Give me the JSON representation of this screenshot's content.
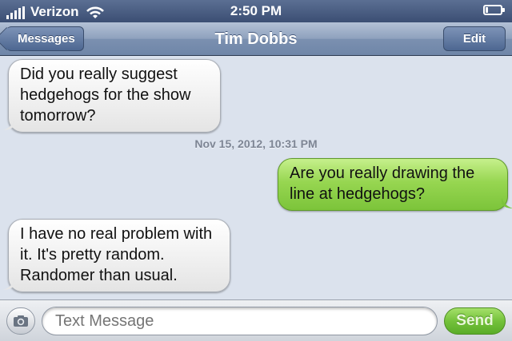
{
  "status_bar": {
    "carrier": "Verizon",
    "time": "2:50 PM",
    "icons": [
      "signal-bars-icon",
      "wifi-icon",
      "battery-icon"
    ]
  },
  "nav": {
    "back_label": "Messages",
    "title": "Tim Dobbs",
    "edit_label": "Edit"
  },
  "messages": [
    {
      "direction": "incoming",
      "text": "Did you really suggest hedgehogs for the show tomorrow?"
    },
    {
      "type": "timestamp",
      "text": "Nov 15, 2012, 10:31 PM"
    },
    {
      "direction": "outgoing",
      "text": "Are you really drawing the line at hedgehogs?"
    },
    {
      "direction": "incoming",
      "text": "I have no real problem with it. It's pretty random. Randomer than usual."
    }
  ],
  "composer": {
    "placeholder": "Text Message",
    "send_label": "Send"
  },
  "colors": {
    "incoming_bubble": "#f2f2f2",
    "outgoing_bubble": "#97d651",
    "background": "#dbe2ed",
    "nav_bar": "#8ea1bd"
  }
}
